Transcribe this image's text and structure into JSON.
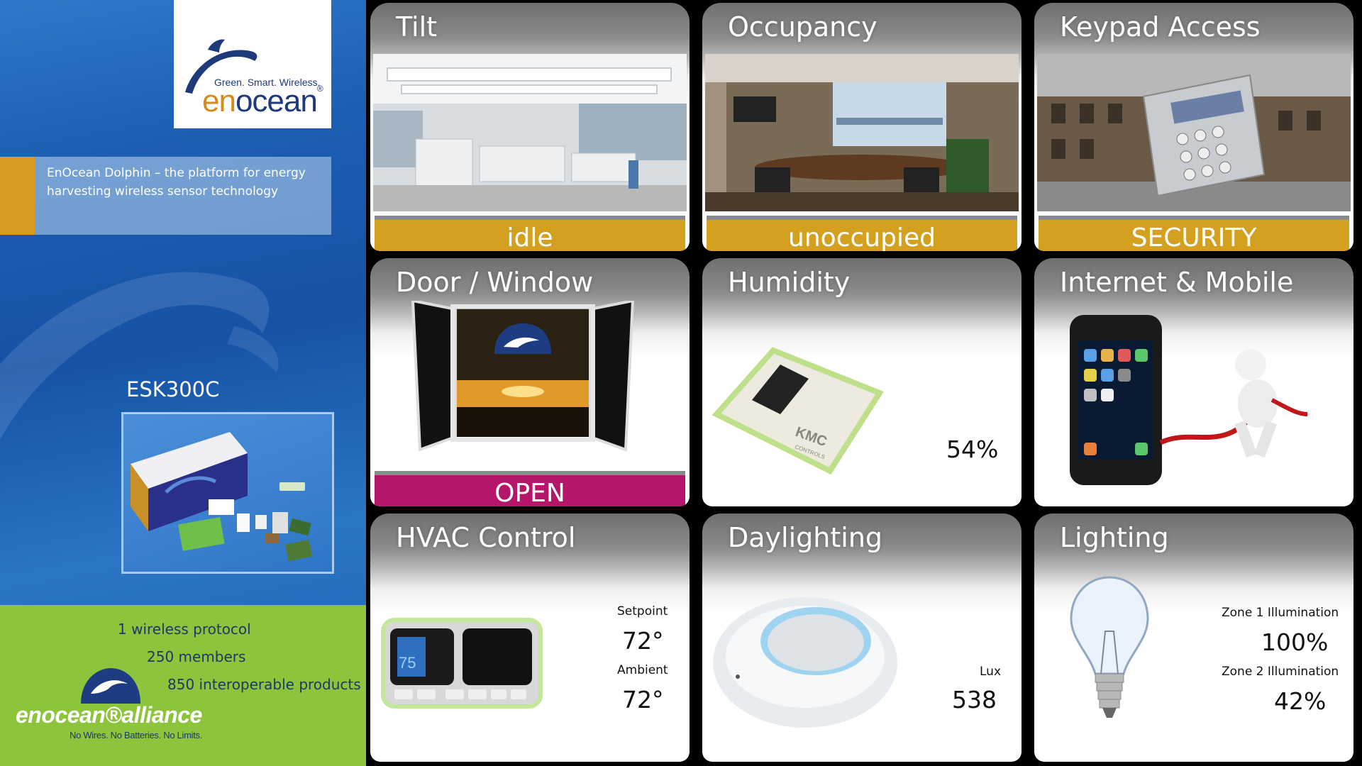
{
  "brand": {
    "tagline": "Green. Smart. Wireless.",
    "wordmark_en": "en",
    "wordmark_ocean": "ocean",
    "reg": "®",
    "description": "EnOcean Dolphin – the platform for energy harvesting wireless sensor technology"
  },
  "kit": {
    "title": "ESK300C"
  },
  "alliance": {
    "stats": [
      "1 wireless protocol",
      "250 members",
      "850 interoperable products"
    ],
    "wordmark": "enocean®alliance",
    "slogan": "No Wires. No Batteries. No Limits."
  },
  "tiles": {
    "tilt": {
      "title": "Tilt",
      "status": "idle"
    },
    "occupancy": {
      "title": "Occupancy",
      "status": "unoccupied"
    },
    "keypad": {
      "title": "Keypad Access",
      "status": "SECURITY"
    },
    "door": {
      "title": "Door / Window",
      "status": "OPEN"
    },
    "humidity": {
      "title": "Humidity",
      "value": "54%",
      "device_brand": "KMC",
      "device_sub": "CONTROLS"
    },
    "internet": {
      "title": "Internet & Mobile"
    },
    "hvac": {
      "title": "HVAC Control",
      "setpoint_label": "Setpoint",
      "setpoint": "72°",
      "ambient_label": "Ambient",
      "ambient": "72°",
      "display_temp": "75"
    },
    "daylighting": {
      "title": "Daylighting",
      "lux_label": "Lux",
      "lux": "538"
    },
    "lighting": {
      "title": "Lighting",
      "zone1_label": "Zone 1 Illumination",
      "zone1": "100%",
      "zone2_label": "Zone 2 Illumination",
      "zone2": "42%"
    }
  },
  "colors": {
    "status_gold": "#d4a020",
    "status_magenta": "#b5166a",
    "panel_blue": "#1d5fb3",
    "panel_green": "#8cc43c",
    "accent_orange": "#d89a20"
  }
}
